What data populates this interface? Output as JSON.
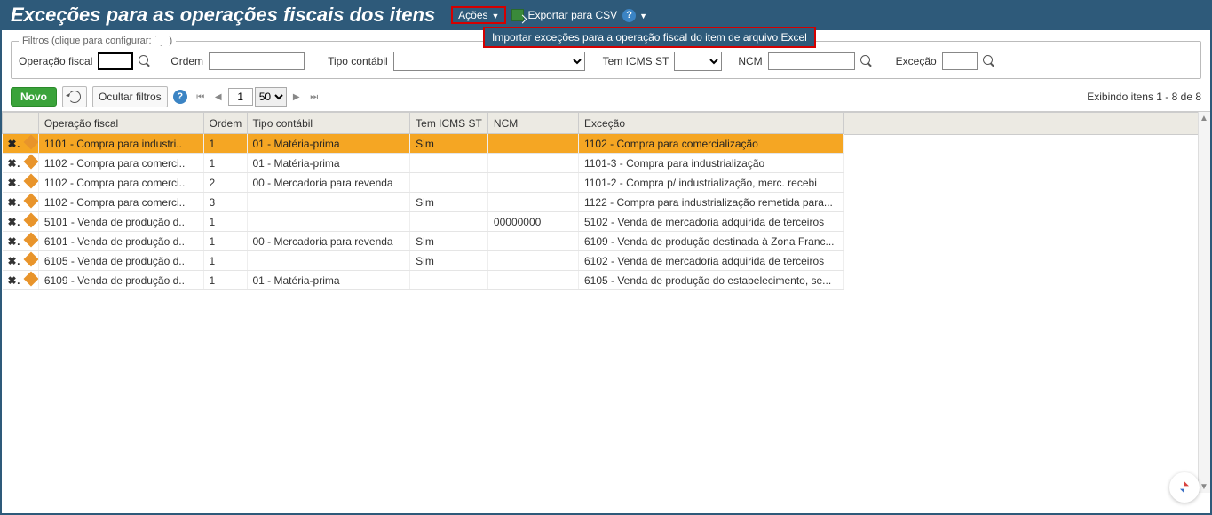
{
  "header": {
    "title": "Exceções para as operações fiscais dos itens",
    "actions_label": "Ações",
    "export_csv_label": "Exportar para CSV",
    "dropdown_item": "Importar exceções para a operação fiscal do item de arquivo Excel"
  },
  "filters": {
    "legend": "Filtros (clique para configurar:",
    "legend_close": ")",
    "operacao_fiscal_label": "Operação fiscal",
    "operacao_fiscal_value": "",
    "ordem_label": "Ordem",
    "ordem_value": "",
    "tipo_contabil_label": "Tipo contábil",
    "tipo_contabil_value": "",
    "tem_icms_label": "Tem ICMS ST",
    "tem_icms_value": "",
    "ncm_label": "NCM",
    "ncm_value": "",
    "excecao_label": "Exceção",
    "excecao_value": ""
  },
  "toolbar": {
    "novo_label": "Novo",
    "ocultar_label": "Ocultar filtros",
    "page_value": "1",
    "page_size": "50",
    "status": "Exibindo itens 1 - 8 de 8"
  },
  "grid": {
    "headers": {
      "operacao": "Operação fiscal",
      "ordem": "Ordem",
      "tipo": "Tipo contábil",
      "icms": "Tem ICMS ST",
      "ncm": "NCM",
      "excecao": "Exceção"
    },
    "rows": [
      {
        "selected": true,
        "op": "1101 - Compra para industri..",
        "ordem": "1",
        "tipo": "01 - Matéria-prima",
        "icms": "Sim",
        "ncm": "",
        "exc": "1102 - Compra para comercialização"
      },
      {
        "selected": false,
        "op": "1102 - Compra para comerci..",
        "ordem": "1",
        "tipo": "01 - Matéria-prima",
        "icms": "",
        "ncm": "",
        "exc": "1101-3 - Compra para industrialização"
      },
      {
        "selected": false,
        "op": "1102 - Compra para comerci..",
        "ordem": "2",
        "tipo": "00 - Mercadoria para revenda",
        "icms": "",
        "ncm": "",
        "exc": "1101-2 - Compra p/ industrialização, merc. recebi"
      },
      {
        "selected": false,
        "op": "1102 - Compra para comerci..",
        "ordem": "3",
        "tipo": "",
        "icms": "Sim",
        "ncm": "",
        "exc": "1122 - Compra para industrialização remetida para..."
      },
      {
        "selected": false,
        "op": "5101 - Venda de produção d..",
        "ordem": "1",
        "tipo": "",
        "icms": "",
        "ncm": "00000000",
        "exc": "5102 - Venda de mercadoria adquirida de terceiros"
      },
      {
        "selected": false,
        "op": "6101 - Venda de produção d..",
        "ordem": "1",
        "tipo": "00 - Mercadoria para revenda",
        "icms": "Sim",
        "ncm": "",
        "exc": "6109 - Venda de produção destinada à Zona Franc..."
      },
      {
        "selected": false,
        "op": "6105 - Venda de produção d..",
        "ordem": "1",
        "tipo": "",
        "icms": "Sim",
        "ncm": "",
        "exc": "6102 - Venda de mercadoria adquirida de terceiros"
      },
      {
        "selected": false,
        "op": "6109 - Venda de produção d..",
        "ordem": "1",
        "tipo": "01 - Matéria-prima",
        "icms": "",
        "ncm": "",
        "exc": "6105 - Venda de produção do estabelecimento, se..."
      }
    ]
  }
}
